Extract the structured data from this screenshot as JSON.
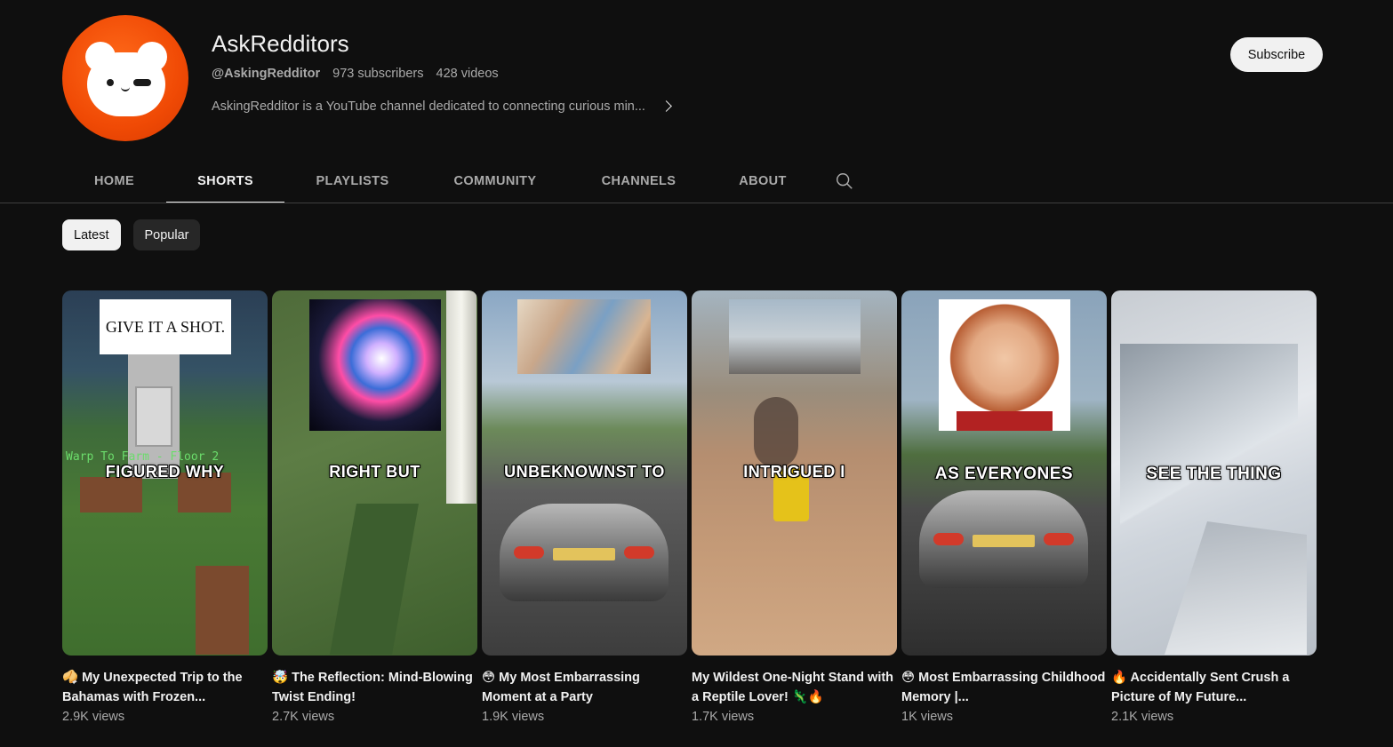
{
  "channel": {
    "name": "AskRedditors",
    "handle": "@AskingRedditor",
    "subscribers": "973 subscribers",
    "videos": "428 videos",
    "description": "AskingRedditor is a YouTube channel dedicated to connecting curious min...",
    "subscribe_label": "Subscribe"
  },
  "tabs": [
    {
      "label": "HOME",
      "active": false
    },
    {
      "label": "SHORTS",
      "active": true
    },
    {
      "label": "PLAYLISTS",
      "active": false
    },
    {
      "label": "COMMUNITY",
      "active": false
    },
    {
      "label": "CHANNELS",
      "active": false
    },
    {
      "label": "ABOUT",
      "active": false
    }
  ],
  "chips": [
    {
      "label": "Latest",
      "active": true
    },
    {
      "label": "Popular",
      "active": false
    }
  ],
  "shorts": [
    {
      "title": "🥠 My Unexpected Trip to the Bahamas with Frozen...",
      "views": "2.9K views",
      "overlay_text": "FIGURED WHY",
      "inset_text": "GIVE IT A SHOT.",
      "game_text": "Warp To Farm - Floor 2"
    },
    {
      "title": "🤯 The Reflection: Mind-Blowing Twist Ending!",
      "views": "2.7K views",
      "overlay_text": "RIGHT BUT"
    },
    {
      "title": "😳 My Most Embarrassing Moment at a Party",
      "views": "1.9K views",
      "overlay_text": "UNBEKNOWNST TO"
    },
    {
      "title": "My Wildest One-Night Stand with a Reptile Lover! 🦎🔥",
      "views": "1.7K views",
      "overlay_text": "INTRIGUED I"
    },
    {
      "title": "😳 Most Embarrassing Childhood Memory |...",
      "views": "1K views",
      "overlay_text": "AS EVERYONES"
    },
    {
      "title": "🔥 Accidentally Sent Crush a Picture of My Future...",
      "views": "2.1K views",
      "overlay_text": "SEE THE THING"
    }
  ],
  "icons": {
    "search": "search-icon",
    "chevron": "chevron-right-icon"
  },
  "colors": {
    "background": "#0f0f0f",
    "avatar": "#f04a05",
    "text_secondary": "#aaaaaa"
  }
}
